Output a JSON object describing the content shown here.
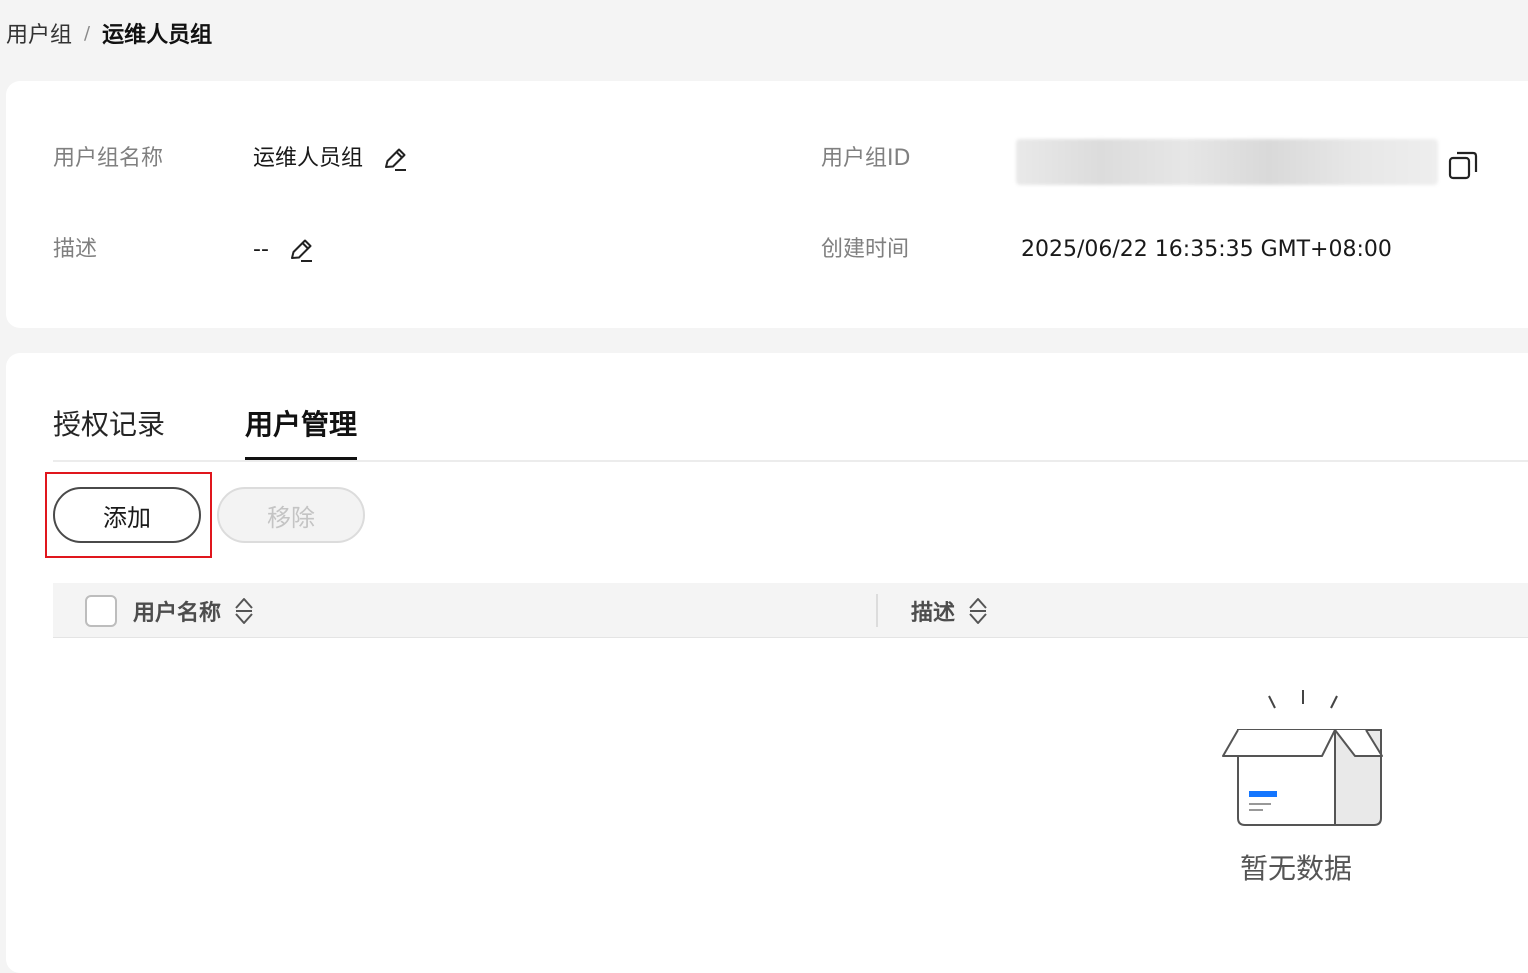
{
  "breadcrumb": {
    "parent": "用户组",
    "separator": "/",
    "current": "运维人员组"
  },
  "info": {
    "name_label": "用户组名称",
    "name_value": "运维人员组",
    "desc_label": "描述",
    "desc_value": "--",
    "id_label": "用户组ID",
    "created_label": "创建时间",
    "created_value": "2025/06/22 16:35:35 GMT+08:00"
  },
  "tabs": [
    {
      "label": "授权记录",
      "active": false
    },
    {
      "label": "用户管理",
      "active": true
    }
  ],
  "toolbar": {
    "add_label": "添加",
    "remove_label": "移除"
  },
  "table": {
    "columns": [
      "用户名称",
      "描述"
    ]
  },
  "empty": {
    "text": "暂无数据"
  },
  "colors": {
    "highlight": "#e0161d",
    "accent": "#1476ff"
  },
  "icons": [
    "edit-icon",
    "copy-icon",
    "sort-icon",
    "empty-box-icon"
  ]
}
